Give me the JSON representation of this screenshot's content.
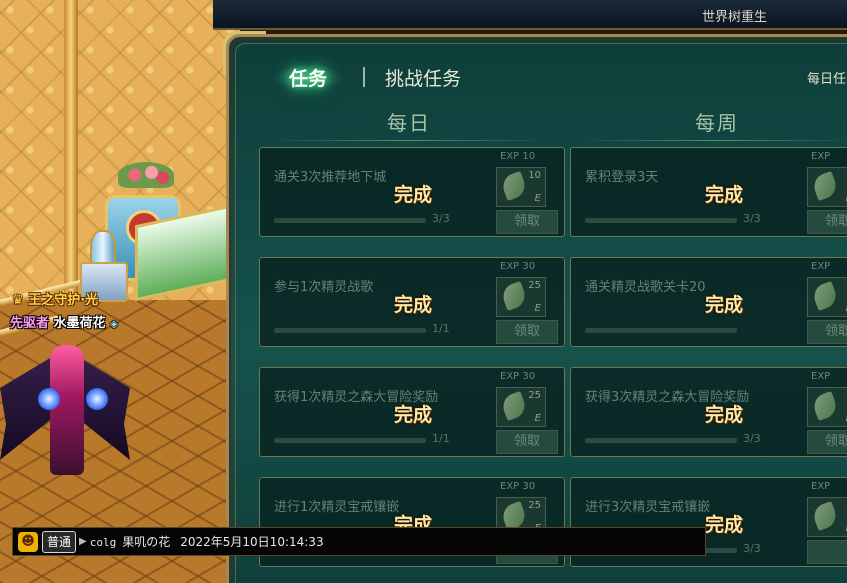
{
  "banner": {
    "title": "世界树重生"
  },
  "tabs": [
    {
      "label": "任务",
      "active": true
    },
    {
      "label": "挑战任务",
      "active": false
    }
  ],
  "daily_link": "每日任",
  "columns": {
    "daily": "每日",
    "weekly": "每周"
  },
  "daily_tasks": [
    {
      "task": "通关3次推荐地下城",
      "status": "完成",
      "progress": "3/3",
      "exp": "EXP 10",
      "reward_count": "10",
      "claim": "领取"
    },
    {
      "task": "参与1次精灵战歌",
      "status": "完成",
      "progress": "1/1",
      "exp": "EXP 30",
      "reward_count": "25",
      "claim": "领取"
    },
    {
      "task": "获得1次精灵之森大冒险奖励",
      "status": "完成",
      "progress": "1/1",
      "exp": "EXP 30",
      "reward_count": "25",
      "claim": "领取"
    },
    {
      "task": "进行1次精灵宝戒镶嵌",
      "status": "完成",
      "progress": "",
      "exp": "EXP 30",
      "reward_count": "25",
      "claim": ""
    }
  ],
  "weekly_tasks": [
    {
      "task": "累积登录3天",
      "status": "完成",
      "progress": "3/3",
      "exp": "EXP",
      "reward_count": "",
      "claim": "领取"
    },
    {
      "task": "通关精灵战歌关卡20",
      "status": "完成",
      "progress": "",
      "exp": "EXP",
      "reward_count": "",
      "claim": "领取"
    },
    {
      "task": "获得3次精灵之森大冒险奖励",
      "status": "完成",
      "progress": "3/3",
      "exp": "EXP",
      "reward_count": "",
      "claim": "领取"
    },
    {
      "task": "进行3次精灵宝戒镶嵌",
      "status": "完成",
      "progress": "3/3",
      "exp": "EXP",
      "reward_count": "",
      "claim": ""
    }
  ],
  "character": {
    "title": "王之守护·光",
    "role": "先驱者",
    "name": "水墨荷花"
  },
  "chat": {
    "channel": "普通",
    "source": "colg",
    "author": "果叽の花",
    "timestamp": "2022年5月10日10:14:33"
  },
  "icons": {
    "emote": "smile-icon",
    "reward": "leaf-icon",
    "gem": "diamond-icon"
  }
}
